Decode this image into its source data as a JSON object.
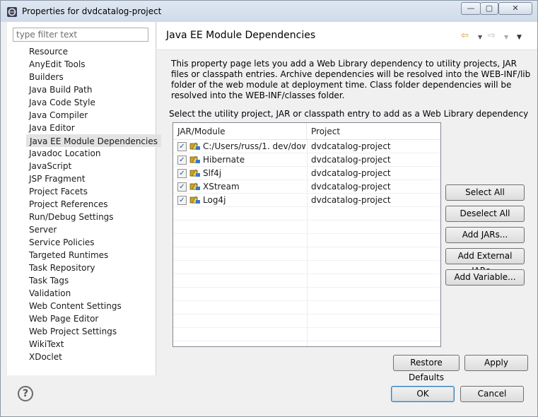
{
  "window": {
    "title": "Properties for dvdcatalog-project",
    "minimize_glyph": "—",
    "maximize_glyph": "▢",
    "close_glyph": "✕"
  },
  "nav": {
    "filter_placeholder": "type filter text",
    "items": [
      {
        "label": "Resource"
      },
      {
        "label": "AnyEdit Tools"
      },
      {
        "label": "Builders"
      },
      {
        "label": "Java Build Path"
      },
      {
        "label": "Java Code Style"
      },
      {
        "label": "Java Compiler"
      },
      {
        "label": "Java Editor"
      },
      {
        "label": "Java EE Module Dependencies",
        "selected": true
      },
      {
        "label": "Javadoc Location"
      },
      {
        "label": "JavaScript"
      },
      {
        "label": "JSP Fragment"
      },
      {
        "label": "Project Facets"
      },
      {
        "label": "Project References"
      },
      {
        "label": "Run/Debug Settings"
      },
      {
        "label": "Server"
      },
      {
        "label": "Service Policies"
      },
      {
        "label": "Targeted Runtimes"
      },
      {
        "label": "Task Repository"
      },
      {
        "label": "Task Tags"
      },
      {
        "label": "Validation"
      },
      {
        "label": "Web Content Settings"
      },
      {
        "label": "Web Page Editor"
      },
      {
        "label": "Web Project Settings"
      },
      {
        "label": "WikiText"
      },
      {
        "label": "XDoclet"
      }
    ]
  },
  "page": {
    "title": "Java EE Module Dependencies",
    "description": "This property page lets you add a Web Library dependency to utility projects, JAR files or classpath entries. Archive dependencies will be resolved into the WEB-INF/lib folder of the web module at deployment time. Class folder dependencies will be resolved into the WEB-INF/classes folder.",
    "instruction": "Select the utility project, JAR or classpath entry to add as a Web Library dependency",
    "icons": {
      "back": "⇦",
      "back_drop": "▼",
      "forward": "⇨",
      "forward_drop": "▼",
      "menu": "▼"
    }
  },
  "table": {
    "columns": [
      "JAR/Module",
      "Project"
    ],
    "rows": [
      {
        "module": "C:/Users/russ/1. dev/dow…",
        "project": "dvdcatalog-project",
        "checked": true
      },
      {
        "module": "Hibernate",
        "project": "dvdcatalog-project",
        "checked": true
      },
      {
        "module": "Slf4j",
        "project": "dvdcatalog-project",
        "checked": true
      },
      {
        "module": "XStream",
        "project": "dvdcatalog-project",
        "checked": true
      },
      {
        "module": "Log4j",
        "project": "dvdcatalog-project",
        "checked": true
      }
    ],
    "check_glyph": "✓"
  },
  "buttons": {
    "select_all": "Select All",
    "deselect_all": "Deselect All",
    "add_jars": "Add JARs...",
    "add_external_jars": "Add External JARs...",
    "add_variable": "Add Variable...",
    "restore_defaults": "Restore Defaults",
    "apply": "Apply",
    "ok": "OK",
    "cancel": "Cancel",
    "help": "?"
  }
}
